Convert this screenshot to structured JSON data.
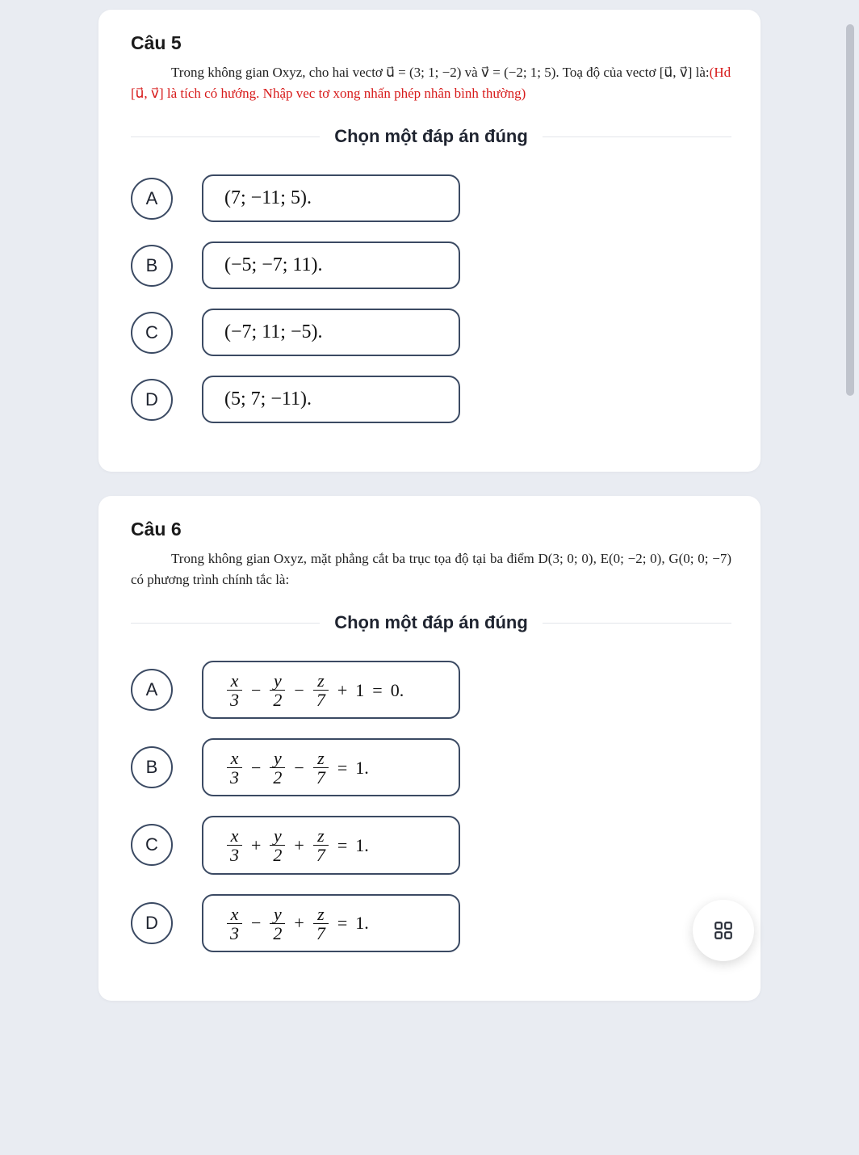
{
  "scrollbar": {
    "present": true
  },
  "fab": {
    "name": "grid-icon"
  },
  "questions": [
    {
      "number": "Câu 5",
      "body_plain": "Trong không gian Oxyz, cho hai vectơ u⃗ = (3; 1; −2) và v⃗ = (−2; 1; 5). Toạ độ của vectơ [u⃗, v⃗] là:",
      "hint": "(Hd  [u⃗, v⃗] là tích có hướng. Nhập vec tơ xong nhấn phép nhân bình thường)",
      "prompt": "Chọn một đáp án đúng",
      "options": [
        {
          "letter": "A",
          "text": "(7; −11; 5)."
        },
        {
          "letter": "B",
          "text": "(−5; −7; 11)."
        },
        {
          "letter": "C",
          "text": "(−7; 11; −5)."
        },
        {
          "letter": "D",
          "text": "(5; 7; −11)."
        }
      ]
    },
    {
      "number": "Câu 6",
      "body_plain": "Trong không gian Oxyz, mặt phẳng cắt ba trục tọa độ tại ba điểm D(3; 0; 0), E(0; −2; 0), G(0; 0; −7) có phương trình chính tắc là:",
      "prompt": "Chọn một đáp án đúng",
      "options": [
        {
          "letter": "A",
          "math": {
            "terms": [
              {
                "num": "x",
                "den": "3"
              },
              {
                "op": "−"
              },
              {
                "num": "y",
                "den": "2"
              },
              {
                "op": "−"
              },
              {
                "num": "z",
                "den": "7"
              },
              {
                "op": "+"
              },
              {
                "plain": "1"
              },
              {
                "op": "="
              },
              {
                "plain": "0."
              }
            ]
          }
        },
        {
          "letter": "B",
          "math": {
            "terms": [
              {
                "num": "x",
                "den": "3"
              },
              {
                "op": "−"
              },
              {
                "num": "y",
                "den": "2"
              },
              {
                "op": "−"
              },
              {
                "num": "z",
                "den": "7"
              },
              {
                "op": "="
              },
              {
                "plain": "1."
              }
            ]
          }
        },
        {
          "letter": "C",
          "math": {
            "terms": [
              {
                "num": "x",
                "den": "3"
              },
              {
                "op": "+"
              },
              {
                "num": "y",
                "den": "2"
              },
              {
                "op": "+"
              },
              {
                "num": "z",
                "den": "7"
              },
              {
                "op": "="
              },
              {
                "plain": "1."
              }
            ]
          }
        },
        {
          "letter": "D",
          "math": {
            "terms": [
              {
                "num": "x",
                "den": "3"
              },
              {
                "op": "−"
              },
              {
                "num": "y",
                "den": "2"
              },
              {
                "op": "+"
              },
              {
                "num": "z",
                "den": "7"
              },
              {
                "op": "="
              },
              {
                "plain": "1."
              }
            ]
          }
        }
      ]
    }
  ]
}
